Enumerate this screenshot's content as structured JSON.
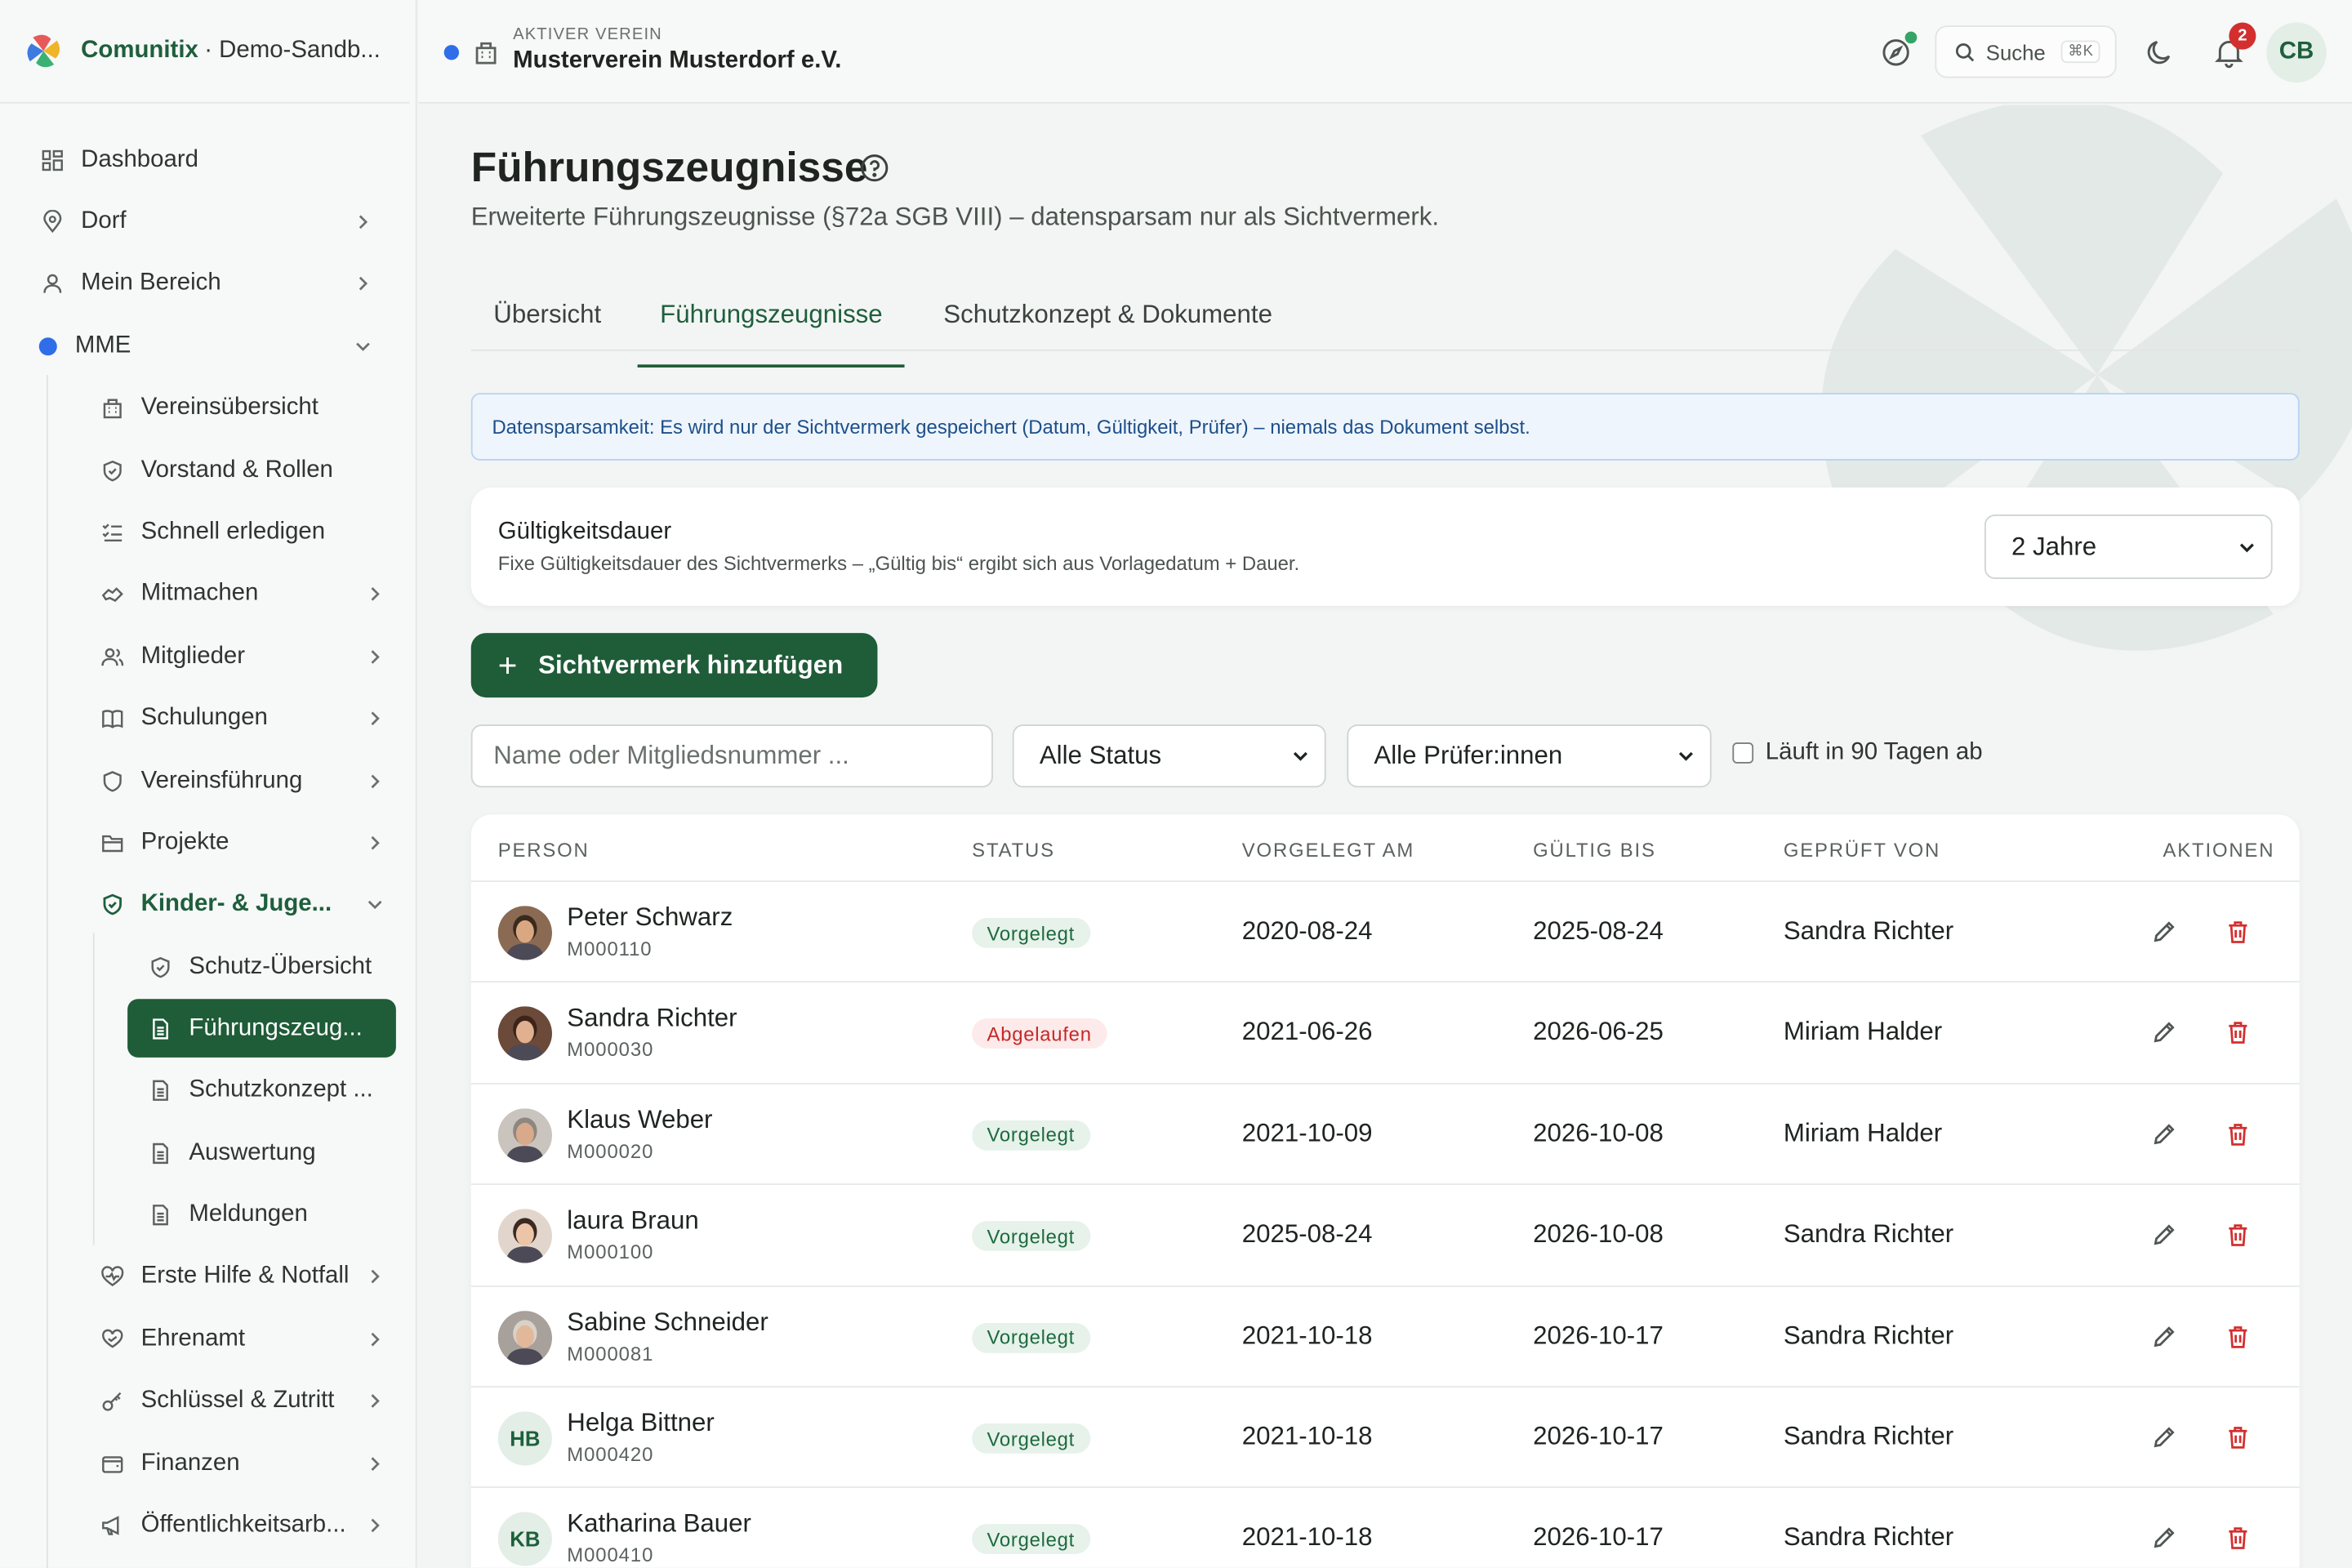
{
  "brand": {
    "name": "Comunitix",
    "sub": "· Demo-Sandb..."
  },
  "sidebar": {
    "items": [
      {
        "label": "Dashboard",
        "icon": "dashboard-icon"
      },
      {
        "label": "Dorf",
        "icon": "map-pin-icon"
      },
      {
        "label": "Mein Bereich",
        "icon": "user-icon"
      },
      {
        "label": "MME",
        "icon": "dot-icon"
      },
      {
        "label": "Vereinsübersicht",
        "icon": "building-icon"
      },
      {
        "label": "Vorstand & Rollen",
        "icon": "shield-check-icon"
      },
      {
        "label": "Schnell erledigen",
        "icon": "checklist-icon"
      },
      {
        "label": "Mitmachen",
        "icon": "handshake-icon"
      },
      {
        "label": "Mitglieder",
        "icon": "users-icon"
      },
      {
        "label": "Schulungen",
        "icon": "book-icon"
      },
      {
        "label": "Vereinsführung",
        "icon": "shield-icon"
      },
      {
        "label": "Projekte",
        "icon": "folder-icon"
      },
      {
        "label": "Kinder- & Juge...",
        "icon": "shield-check-icon"
      },
      {
        "label": "Schutz-Übersicht",
        "icon": "shield-check-icon"
      },
      {
        "label": "Führungszeug...",
        "icon": "document-icon"
      },
      {
        "label": "Schutzkonzept ...",
        "icon": "document-icon"
      },
      {
        "label": "Auswertung",
        "icon": "document-icon"
      },
      {
        "label": "Meldungen",
        "icon": "document-icon"
      },
      {
        "label": "Erste Hilfe & Notfall",
        "icon": "heart-pulse-icon"
      },
      {
        "label": "Ehrenamt",
        "icon": "heart-hand-icon"
      },
      {
        "label": "Schlüssel & Zutritt",
        "icon": "key-icon"
      },
      {
        "label": "Finanzen",
        "icon": "wallet-icon"
      },
      {
        "label": "Öffentlichkeitsarb...",
        "icon": "megaphone-icon"
      }
    ]
  },
  "topbar": {
    "club_label": "AKTIVER VEREIN",
    "club_name": "Musterverein Musterdorf e.V.",
    "search_label": "Suche",
    "search_kbd": "⌘K",
    "notif_count": "2",
    "user_initials": "CB"
  },
  "page": {
    "title": "Führungszeugnisse",
    "subtitle": "Erweiterte Führungszeugnisse (§72a SGB VIII) – datensparsam nur als Sichtvermerk.",
    "tabs": [
      "Übersicht",
      "Führungszeugnisse",
      "Schutzkonzept & Dokumente"
    ],
    "active_tab": "Führungszeugnisse",
    "info": "Datensparsamkeit: Es wird nur der Sichtvermerk gespeichert (Datum, Gültigkeit, Prüfer) – niemals das Dokument selbst.",
    "validity": {
      "title": "Gültigkeitsdauer",
      "desc": "Fixe Gültigkeitsdauer des Sichtvermerks – „Gültig bis“ ergibt sich aus Vorlagedatum + Dauer.",
      "selected": "2 Jahre"
    },
    "add_button": "Sichtvermerk hinzufügen",
    "filters": {
      "search_placeholder": "Name oder Mitgliedsnummer ...",
      "status": "Alle Status",
      "reviewer": "Alle Prüfer:innen",
      "expiring": "Läuft in 90 Tagen ab"
    }
  },
  "table": {
    "headers": [
      "PERSON",
      "STATUS",
      "VORGELEGT AM",
      "GÜLTIG BIS",
      "GEPRÜFT VON",
      "AKTIONEN"
    ],
    "rows": [
      {
        "name": "Peter Schwarz",
        "id": "M000110",
        "status": "Vorgelegt",
        "submitted": "2020-08-24",
        "valid": "2025-08-24",
        "reviewer": "Sandra Richter",
        "avatar": "photo"
      },
      {
        "name": "Sandra Richter",
        "id": "M000030",
        "status": "Abgelaufen",
        "submitted": "2021-06-26",
        "valid": "2026-06-25",
        "reviewer": "Miriam Halder",
        "avatar": "photo"
      },
      {
        "name": "Klaus Weber",
        "id": "M000020",
        "status": "Vorgelegt",
        "submitted": "2021-10-09",
        "valid": "2026-10-08",
        "reviewer": "Miriam Halder",
        "avatar": "photo"
      },
      {
        "name": "laura Braun",
        "id": "M000100",
        "status": "Vorgelegt",
        "submitted": "2025-08-24",
        "valid": "2026-10-08",
        "reviewer": "Sandra Richter",
        "avatar": "photo"
      },
      {
        "name": "Sabine Schneider",
        "id": "M000081",
        "status": "Vorgelegt",
        "submitted": "2021-10-18",
        "valid": "2026-10-17",
        "reviewer": "Sandra Richter",
        "avatar": "photo"
      },
      {
        "name": "Helga Bittner",
        "id": "M000420",
        "status": "Vorgelegt",
        "submitted": "2021-10-18",
        "valid": "2026-10-17",
        "reviewer": "Sandra Richter",
        "avatar": "HB"
      },
      {
        "name": "Katharina Bauer",
        "id": "M000410",
        "status": "Vorgelegt",
        "submitted": "2021-10-18",
        "valid": "2026-10-17",
        "reviewer": "Sandra Richter",
        "avatar": "KB"
      }
    ]
  },
  "colors": {
    "brand_green": "#1f5c38",
    "accent_blue": "#2f6ee8",
    "danger": "#d32f2f"
  }
}
